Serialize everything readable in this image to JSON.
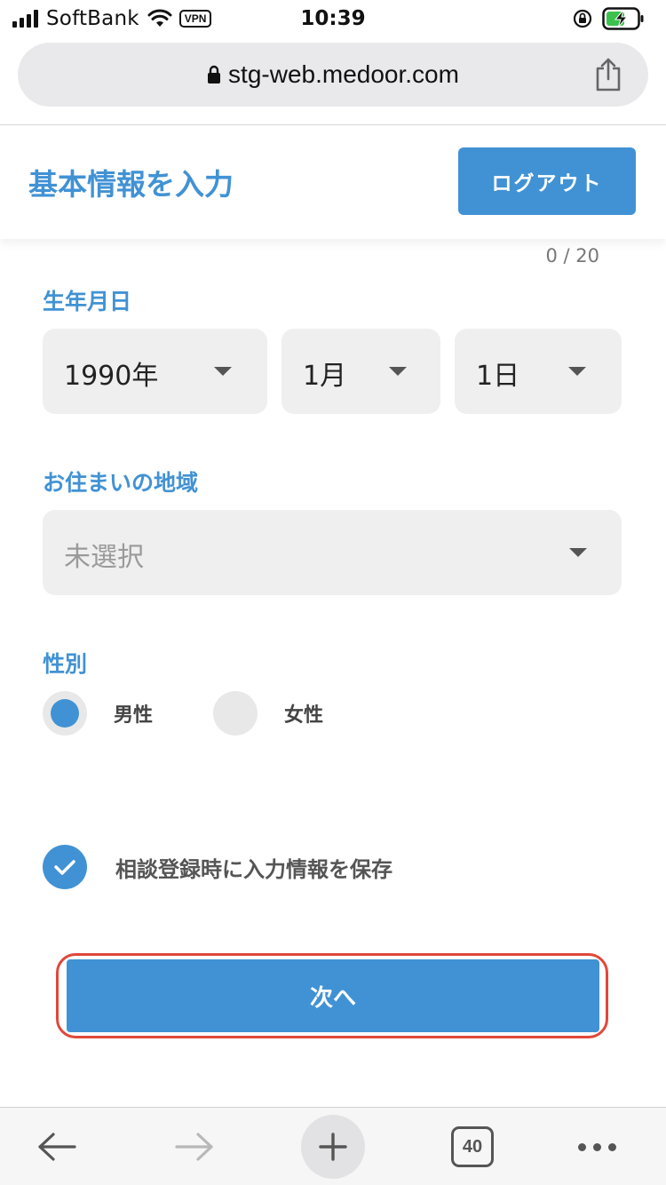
{
  "status_bar": {
    "carrier": "SoftBank",
    "vpn": "VPN",
    "time": "10:39",
    "icons": [
      "signal-icon",
      "wifi-icon",
      "orientation-lock-icon",
      "battery-charging-icon"
    ]
  },
  "browser": {
    "url": "stg-web.medoor.com",
    "icons": [
      "lock-icon",
      "share-icon"
    ]
  },
  "header": {
    "title": "基本情報を入力",
    "logout_label": "ログアウト"
  },
  "form": {
    "char_counter": "0 / 20",
    "birthday": {
      "label": "生年月日",
      "year": "1990年",
      "month": "1月",
      "day": "1日"
    },
    "region": {
      "label": "お住まいの地域",
      "value": "未選択"
    },
    "gender": {
      "label": "性別",
      "options": [
        {
          "label": "男性",
          "selected": true
        },
        {
          "label": "女性",
          "selected": false
        }
      ]
    },
    "save_info": {
      "label": "相談登録時に入力情報を保存",
      "checked": true
    },
    "next_label": "次へ"
  },
  "toolbar": {
    "tab_count": "40",
    "icons": [
      "back-arrow-icon",
      "forward-arrow-icon",
      "new-tab-plus-icon",
      "tabs-icon",
      "more-icon"
    ]
  },
  "colors": {
    "accent": "#4192d4",
    "highlight_border": "#e0483a",
    "field_bg": "#efefef"
  }
}
